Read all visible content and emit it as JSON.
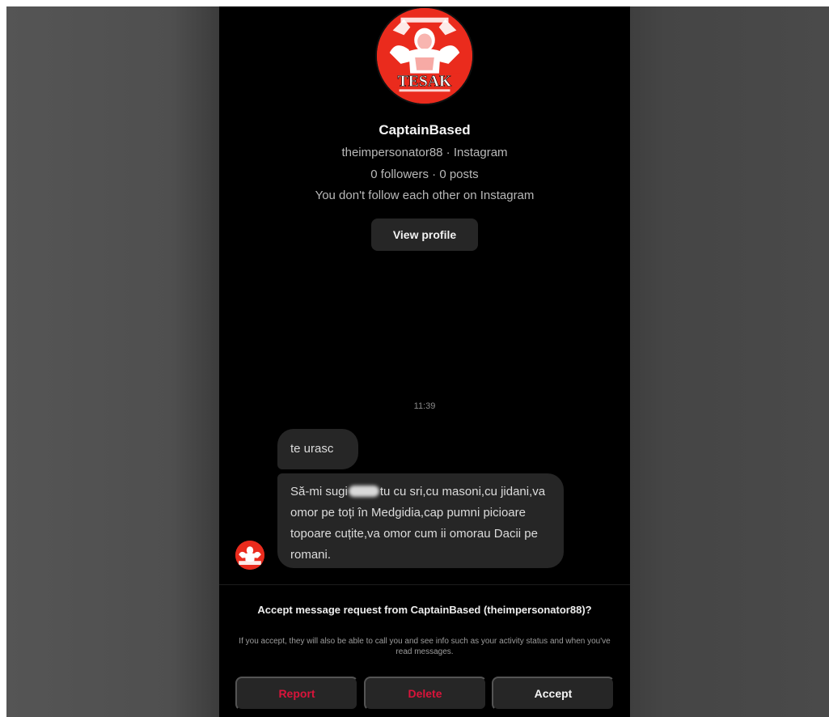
{
  "profile": {
    "display_name": "CaptainBased",
    "username_line": "theimpersonator88 · Instagram",
    "stats_line": "0 followers · 0 posts",
    "follow_status": "You don't follow each other on Instagram",
    "view_profile_label": "View profile",
    "avatar_text": "TESAK"
  },
  "thread": {
    "timestamp": "11:39",
    "messages": [
      {
        "text": "te urasc"
      },
      {
        "text_before_redaction": "Să-mi sugi",
        "text_after_redaction": "tu cu sri,cu masoni,cu jidani,va omor pe toți în Medgidia,cap pumni picioare topoare cuțite,va omor cum ii omorau Dacii pe romani."
      }
    ]
  },
  "request": {
    "title": "Accept message request from CaptainBased (theimpersonator88)?",
    "subtitle": "If you accept, they will also be able to call you and see info such as your activity status and when you've read messages.",
    "report_label": "Report",
    "delete_label": "Delete",
    "accept_label": "Accept"
  },
  "colors": {
    "avatar_red": "#ea2b1d",
    "danger_red": "#d9143b",
    "bubble_gray": "#262626"
  }
}
